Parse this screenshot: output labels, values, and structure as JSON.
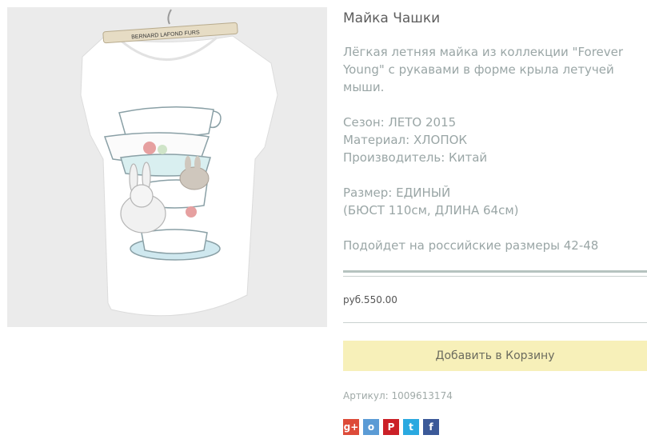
{
  "product": {
    "title": "Майка Чашки",
    "description": "Лёгкая летняя майка из коллекции \"Forever Young\" с рукавами в форме крыла летучей мыши.",
    "season": "Сезон: ЛЕТО 2015",
    "material": "Материал: ХЛОПОК",
    "manufacturer": "Производитель: Китай",
    "size": "Размер: ЕДИНЫЙ",
    "measurements": "(БЮСТ 110см, ДЛИНА 64см)",
    "fit_note": "Подойдет на российские размеры 42-48",
    "price": "руб.550.00",
    "add_to_cart_label": "Добавить в Корзину",
    "sku": "Артикул: 1009613174",
    "hanger_text": "BERNARD LAFOND FURS"
  },
  "share": [
    {
      "icon": "google-plus-icon",
      "glyph": "g+",
      "color": "#dd4b39"
    },
    {
      "icon": "odnoklassniki-icon",
      "glyph": "о",
      "color": "#5b9bd5"
    },
    {
      "icon": "pinterest-icon",
      "glyph": "P",
      "color": "#cb2027"
    },
    {
      "icon": "twitter-icon",
      "glyph": "t",
      "color": "#2aa9e0"
    },
    {
      "icon": "facebook-icon",
      "glyph": "f",
      "color": "#3b5998"
    }
  ]
}
